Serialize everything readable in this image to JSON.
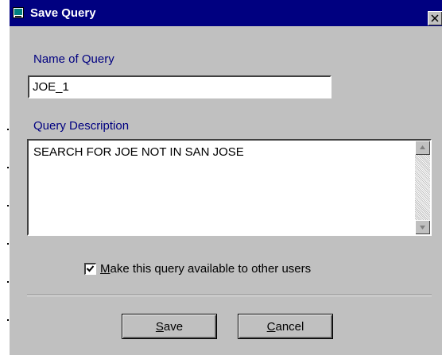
{
  "window": {
    "title": "Save Query"
  },
  "form": {
    "name_label": "Name of Query",
    "name_value": "JOE_1",
    "description_label": "Query Description",
    "description_value": "SEARCH FOR JOE NOT IN SAN JOSE",
    "share_checkbox": {
      "label": "Make this query available to other users",
      "checked": true
    }
  },
  "buttons": {
    "save_label": "Save",
    "cancel_label": "Cancel"
  },
  "colors": {
    "titlebar": "#000080",
    "label": "#000080",
    "face": "#c0c0c0"
  }
}
